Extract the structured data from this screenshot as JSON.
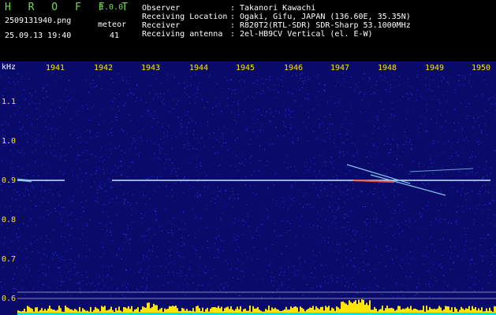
{
  "header": {
    "app_name": "H R O F F T",
    "version": "1.0.0",
    "file_name": "2509131940.png",
    "date_time": "25.09.13 19:40",
    "meteor_label": "meteor",
    "meteor_count": "41"
  },
  "info": [
    {
      "key": "Observer",
      "value": "Takanori Kawachi"
    },
    {
      "key": "Receiving Location",
      "value": "Ogaki, Gifu, JAPAN (136.60E, 35.35N)"
    },
    {
      "key": "Receiver",
      "value": "R820T2(RTL-SDR) SDR-Sharp 53.1000MHz"
    },
    {
      "key": "Receiving antenna",
      "value": "2el-HB9CV Vertical (el. E-W)"
    }
  ],
  "spectrogram": {
    "unit_label": "kHz",
    "x_ticks": [
      "1941",
      "1942",
      "1943",
      "1944",
      "1945",
      "1946",
      "1947",
      "1948",
      "1949",
      "1950"
    ],
    "y_ticks": [
      "1.1",
      "1.0",
      "0.9",
      "0.8",
      "0.7",
      "0.6"
    ],
    "carrier_frequency_khz": 0.9,
    "colors": {
      "background": "#0a0a6a",
      "noise": "#2a3cff",
      "carrier": "#c8e8ff",
      "tick_text": "#ffe600",
      "echo": "#8fd8ff",
      "strong_echo": "#ff5a3c",
      "histogram_yellow": "#ffe600",
      "histogram_cyan": "#00e5ff"
    }
  }
}
